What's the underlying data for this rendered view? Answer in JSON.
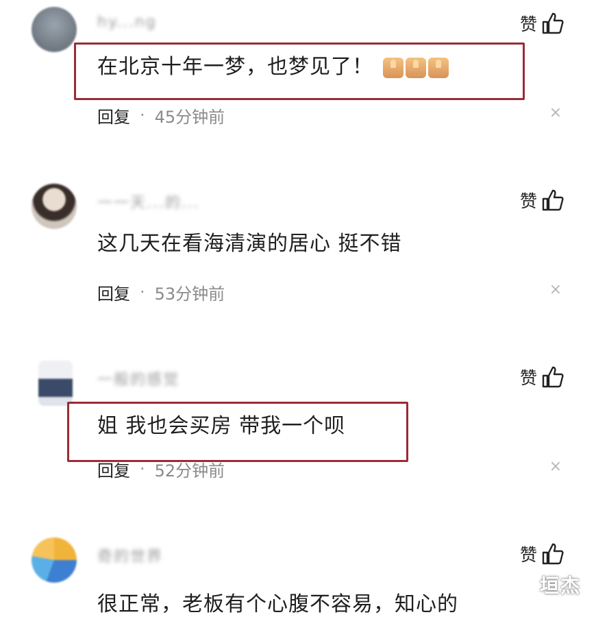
{
  "like_label": "赞",
  "reply_label": "回复",
  "separator": "·",
  "close_glyph": "×",
  "comments": [
    {
      "username": "hy...ng",
      "content": "在北京十年一梦，也梦见了！",
      "time": "45分钟前",
      "emoji": "thumbs-up-emoji",
      "highlighted": true
    },
    {
      "username": "一一天...的...",
      "content": "这几天在看海清演的居心 挺不错",
      "time": "53分钟前",
      "highlighted": false
    },
    {
      "username": "一般的感觉",
      "content": "姐 我也会买房 带我一个呗",
      "time": "52分钟前",
      "highlighted": true
    },
    {
      "username": "奇的世界",
      "content": "很正常，老板有个心腹不容易，知心的",
      "time": "",
      "highlighted": false
    }
  ],
  "watermark": "垣杰",
  "colors": {
    "highlight_border": "#9c2b33",
    "time_text": "#8a8a8a"
  }
}
